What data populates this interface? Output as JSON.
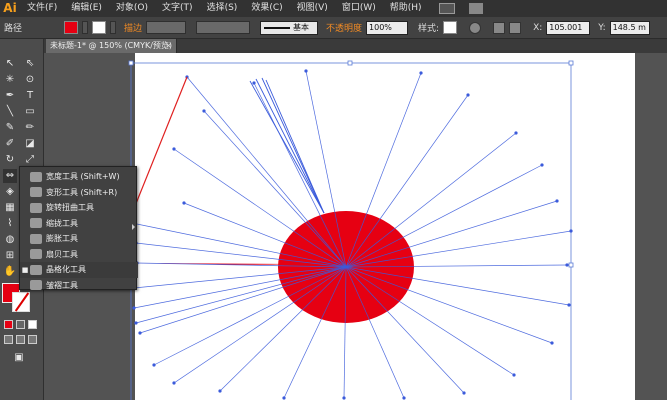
{
  "app": {
    "logo": "Ai"
  },
  "menubar": {
    "items": [
      "文件(F)",
      "编辑(E)",
      "对象(O)",
      "文字(T)",
      "选择(S)",
      "效果(C)",
      "视图(V)",
      "窗口(W)",
      "帮助(H)"
    ]
  },
  "control": {
    "object_label": "路径",
    "stroke_label": "描边",
    "stroke_style": "基本",
    "opacity_label": "不透明度",
    "opacity_value": "100%",
    "style_label": "样式:",
    "x_label": "X:",
    "x_value": "105.001",
    "y_label": "Y:",
    "y_value": "148.5 m",
    "fill_color": "#e60012"
  },
  "document": {
    "tab_title": "未标题-1* @ 150% (CMYK/预览)",
    "close_label": "×"
  },
  "flyout": {
    "items": [
      {
        "label": "宽度工具 (Shift+W)",
        "icon": "width-tool-icon"
      },
      {
        "label": "变形工具 (Shift+R)",
        "icon": "warp-tool-icon"
      },
      {
        "label": "旋转扭曲工具",
        "icon": "twirl-tool-icon"
      },
      {
        "label": "缩拢工具",
        "icon": "pucker-tool-icon"
      },
      {
        "label": "膨胀工具",
        "icon": "bloat-tool-icon"
      },
      {
        "label": "扇贝工具",
        "icon": "scallop-tool-icon"
      },
      {
        "label": "晶格化工具",
        "icon": "crystallize-tool-icon"
      },
      {
        "label": "皱褶工具",
        "icon": "wrinkle-tool-icon"
      }
    ],
    "active_index": 6
  },
  "artwork": {
    "shape_color": "#e60012",
    "path_color": "#3b5bdb",
    "arrow_color": "#e02020"
  }
}
